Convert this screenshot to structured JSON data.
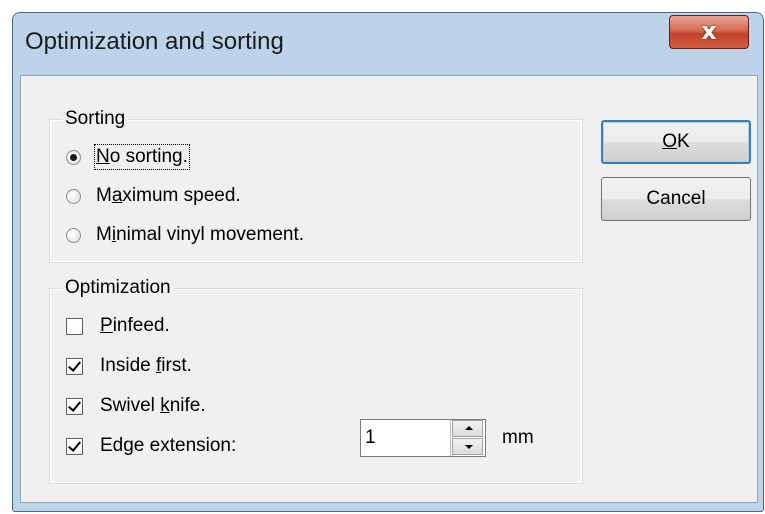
{
  "window": {
    "title": "Optimization and sorting",
    "close_glyph": "x"
  },
  "sorting": {
    "label": "Sorting",
    "options": [
      {
        "pre": "",
        "key": "N",
        "post": "o sorting.",
        "checked": true
      },
      {
        "pre": "M",
        "key": "a",
        "post": "ximum speed.",
        "checked": false
      },
      {
        "pre": "M",
        "key": "i",
        "post": "nimal vinyl movement.",
        "checked": false
      }
    ]
  },
  "optimization": {
    "label": "Optimization",
    "pinfeed": {
      "pre": "",
      "key": "P",
      "post": "infeed.",
      "checked": false
    },
    "inside_first": {
      "pre": "Inside ",
      "key": "f",
      "post": "irst.",
      "checked": true
    },
    "swivel_knife": {
      "pre": "Swivel ",
      "key": "k",
      "post": "nife.",
      "checked": true
    },
    "edge_extension": {
      "pre": "Edge extension:",
      "key": "",
      "post": "",
      "checked": true
    },
    "edge_value": "1",
    "edge_unit": "mm"
  },
  "buttons": {
    "ok": {
      "pre": "",
      "key": "O",
      "post": "K"
    },
    "cancel": "Cancel"
  },
  "colors": {
    "frame": "#bcd3e9",
    "close": "#c3412b",
    "client": "#f0f0f0",
    "default_button_border": "#3c7fb1"
  }
}
